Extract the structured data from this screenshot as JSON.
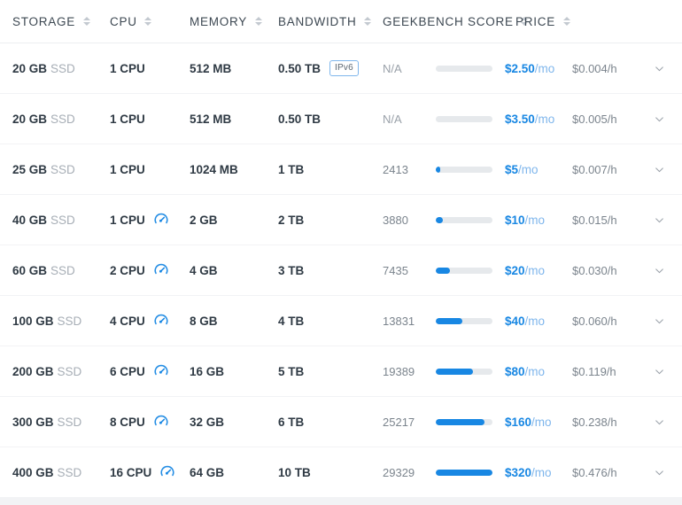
{
  "table": {
    "headers": [
      {
        "label": "STORAGE",
        "name": "storage"
      },
      {
        "label": "CPU",
        "name": "cpu"
      },
      {
        "label": "MEMORY",
        "name": "memory"
      },
      {
        "label": "BANDWIDTH",
        "name": "bandwidth"
      },
      {
        "label": "GEEKBENCH SCORE",
        "name": "geekbench-score"
      },
      {
        "label": "PRICE",
        "name": "price"
      }
    ],
    "rows": [
      {
        "storage_value": "20 GB",
        "storage_unit": "SSD",
        "cpu": "1 CPU",
        "cpu_boost": false,
        "memory": "512 MB",
        "bandwidth": "0.50 TB",
        "ipv6_badge": "IPv6",
        "geekbench": "N/A",
        "geekbench_na": true,
        "bar_percent": 0,
        "price": "$2.50",
        "price_period": "/mo",
        "hourly": "$0.004/h"
      },
      {
        "storage_value": "20 GB",
        "storage_unit": "SSD",
        "cpu": "1 CPU",
        "cpu_boost": false,
        "memory": "512 MB",
        "bandwidth": "0.50 TB",
        "ipv6_badge": "",
        "geekbench": "N/A",
        "geekbench_na": true,
        "bar_percent": 0,
        "price": "$3.50",
        "price_period": "/mo",
        "hourly": "$0.005/h"
      },
      {
        "storage_value": "25 GB",
        "storage_unit": "SSD",
        "cpu": "1 CPU",
        "cpu_boost": false,
        "memory": "1024 MB",
        "bandwidth": "1 TB",
        "ipv6_badge": "",
        "geekbench": "2413",
        "geekbench_na": false,
        "bar_percent": 8,
        "price": "$5",
        "price_period": "/mo",
        "hourly": "$0.007/h"
      },
      {
        "storage_value": "40 GB",
        "storage_unit": "SSD",
        "cpu": "1 CPU",
        "cpu_boost": true,
        "memory": "2 GB",
        "bandwidth": "2 TB",
        "ipv6_badge": "",
        "geekbench": "3880",
        "geekbench_na": false,
        "bar_percent": 13,
        "price": "$10",
        "price_period": "/mo",
        "hourly": "$0.015/h"
      },
      {
        "storage_value": "60 GB",
        "storage_unit": "SSD",
        "cpu": "2 CPU",
        "cpu_boost": true,
        "memory": "4 GB",
        "bandwidth": "3 TB",
        "ipv6_badge": "",
        "geekbench": "7435",
        "geekbench_na": false,
        "bar_percent": 25,
        "price": "$20",
        "price_period": "/mo",
        "hourly": "$0.030/h"
      },
      {
        "storage_value": "100 GB",
        "storage_unit": "SSD",
        "cpu": "4 CPU",
        "cpu_boost": true,
        "memory": "8 GB",
        "bandwidth": "4 TB",
        "ipv6_badge": "",
        "geekbench": "13831",
        "geekbench_na": false,
        "bar_percent": 47,
        "price": "$40",
        "price_period": "/mo",
        "hourly": "$0.060/h"
      },
      {
        "storage_value": "200 GB",
        "storage_unit": "SSD",
        "cpu": "6 CPU",
        "cpu_boost": true,
        "memory": "16 GB",
        "bandwidth": "5 TB",
        "ipv6_badge": "",
        "geekbench": "19389",
        "geekbench_na": false,
        "bar_percent": 66,
        "price": "$80",
        "price_period": "/mo",
        "hourly": "$0.119/h"
      },
      {
        "storage_value": "300 GB",
        "storage_unit": "SSD",
        "cpu": "8 CPU",
        "cpu_boost": true,
        "memory": "32 GB",
        "bandwidth": "6 TB",
        "ipv6_badge": "",
        "geekbench": "25217",
        "geekbench_na": false,
        "bar_percent": 86,
        "price": "$160",
        "price_period": "/mo",
        "hourly": "$0.238/h"
      },
      {
        "storage_value": "400 GB",
        "storage_unit": "SSD",
        "cpu": "16 CPU",
        "cpu_boost": true,
        "memory": "64 GB",
        "bandwidth": "10 TB",
        "ipv6_badge": "",
        "geekbench": "29329",
        "geekbench_na": false,
        "bar_percent": 100,
        "price": "$320",
        "price_period": "/mo",
        "hourly": "$0.476/h"
      }
    ]
  },
  "icons": {
    "sort": "sort-arrows-icon",
    "expand": "chevron-down-icon",
    "cpu_boost": "speedometer-icon"
  },
  "colors": {
    "accent": "#1887e3",
    "accent_light": "#7fb6ec",
    "text": "#3d4852",
    "muted": "#8a9199",
    "track": "#e6e9ec",
    "row_gap": "#f2f3f5"
  },
  "chart_data": {
    "type": "bar",
    "title": "Geekbench Score",
    "xlabel": "",
    "ylabel": "Geekbench Score",
    "categories": [
      "20 GB SSD / 1 CPU / 512 MB",
      "20 GB SSD / 1 CPU / 512 MB",
      "25 GB SSD / 1 CPU / 1024 MB",
      "40 GB SSD / 1 CPU / 2 GB",
      "60 GB SSD / 2 CPU / 4 GB",
      "100 GB SSD / 4 CPU / 8 GB",
      "200 GB SSD / 6 CPU / 16 GB",
      "300 GB SSD / 8 CPU / 32 GB",
      "400 GB SSD / 16 CPU / 64 GB"
    ],
    "values": [
      null,
      null,
      2413,
      3880,
      7435,
      13831,
      19389,
      25217,
      29329
    ],
    "bar_percent": [
      0,
      0,
      8,
      13,
      25,
      47,
      66,
      86,
      100
    ],
    "ylim": [
      0,
      29329
    ],
    "grid": false,
    "legend": "none"
  }
}
